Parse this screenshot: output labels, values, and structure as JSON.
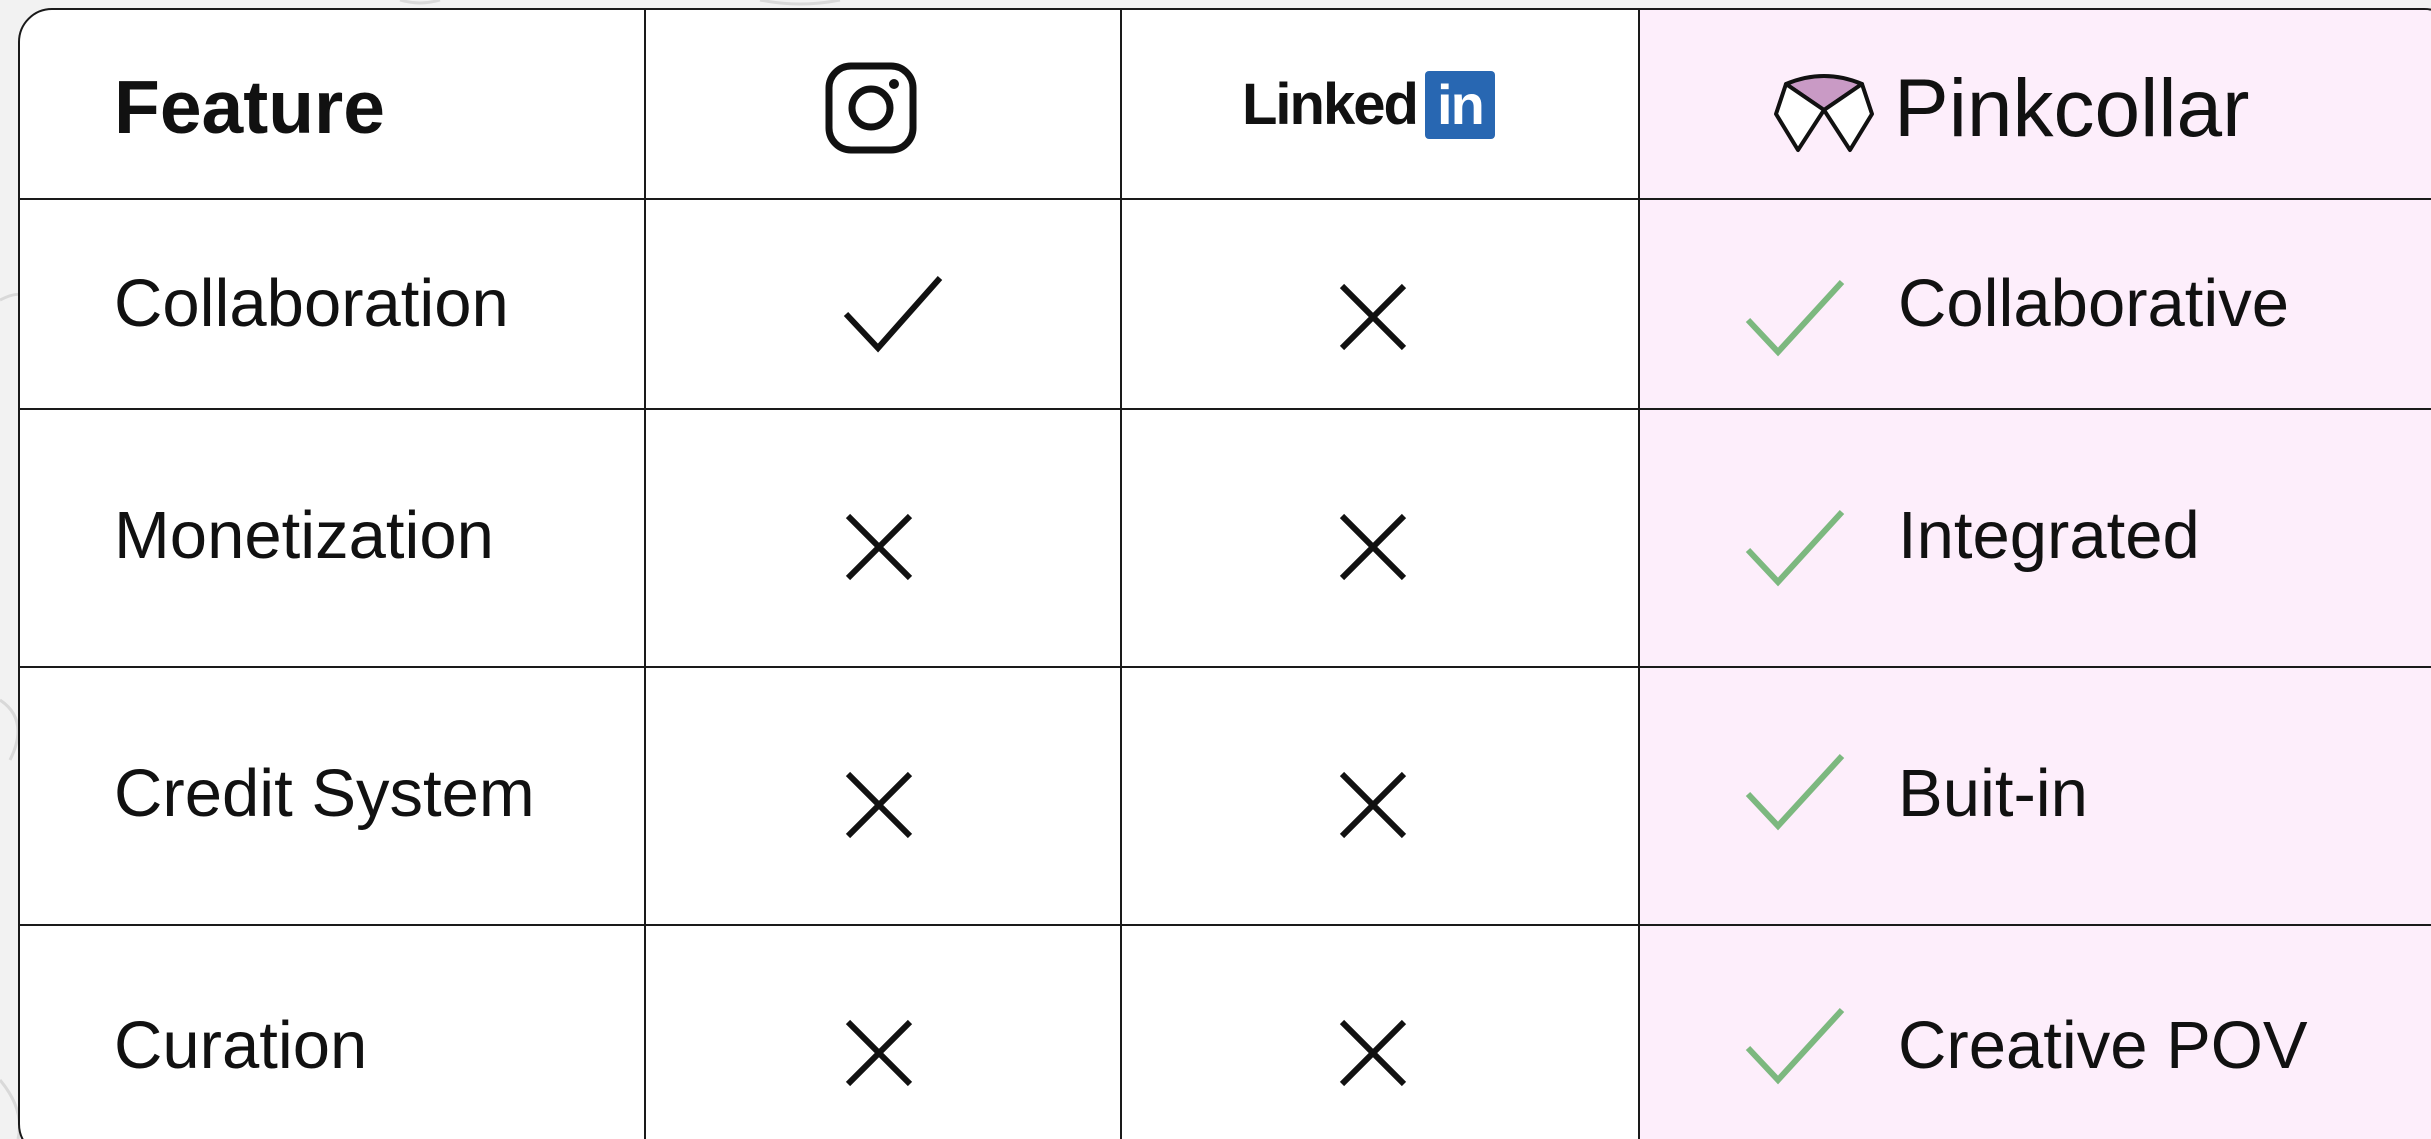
{
  "table": {
    "header": {
      "feature_label": "Feature",
      "col_instagram_icon": "instagram-icon",
      "col_linkedin": {
        "word": "Linked",
        "badge": "in"
      },
      "col_pinkcollar": {
        "icon": "pinkcollar-logo-icon",
        "name": "Pinkcollar"
      }
    },
    "rows": [
      {
        "feature": "Collaboration",
        "instagram": "check",
        "linkedin": "cross",
        "pinkcollar_mark": "check",
        "pinkcollar_text": "Collaborative"
      },
      {
        "feature": "Monetization",
        "instagram": "cross",
        "linkedin": "cross",
        "pinkcollar_mark": "check",
        "pinkcollar_text": "Integrated"
      },
      {
        "feature": "Credit System",
        "instagram": "cross",
        "linkedin": "cross",
        "pinkcollar_mark": "check",
        "pinkcollar_text": "Buit-in"
      },
      {
        "feature": "Curation",
        "instagram": "cross",
        "linkedin": "cross",
        "pinkcollar_mark": "check",
        "pinkcollar_text": "Creative POV"
      }
    ]
  },
  "colors": {
    "pinkcollar_column_bg": "#fdeefb",
    "pinkcollar_check": "#7cb87f",
    "linkedin_blue": "#2867b2",
    "pinkcollar_logo_fill": "#c99ac5",
    "border": "#1a1a1a"
  }
}
